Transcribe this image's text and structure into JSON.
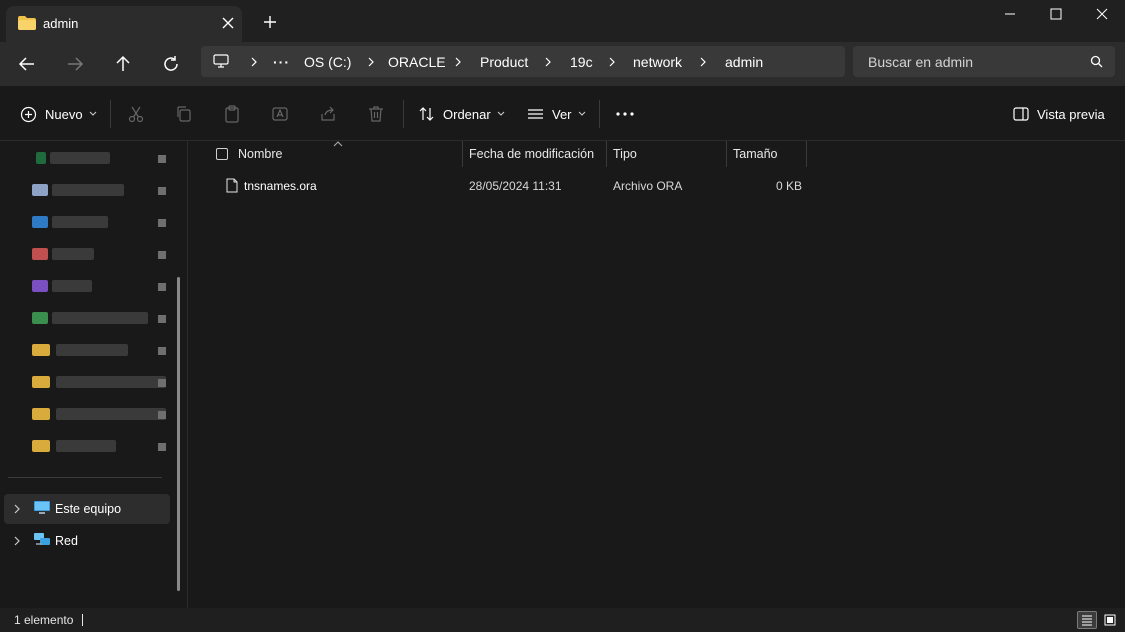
{
  "window": {
    "tab_title": "admin",
    "icons": {
      "folder": "folder-icon",
      "close_tab": "close-icon",
      "new_tab": "plus-icon"
    }
  },
  "nav": {
    "back": "arrow-left-icon",
    "forward": "arrow-right-icon",
    "up": "arrow-up-icon",
    "refresh": "refresh-icon",
    "breadcrumb": [
      "OS (C:)",
      "ORACLE",
      "Product",
      "19c",
      "network",
      "admin"
    ],
    "overflow": "···",
    "search_placeholder": "Buscar en admin"
  },
  "commands": {
    "new": "Nuevo",
    "sort": "Ordenar",
    "view": "Ver",
    "more": "···",
    "preview": "Vista previa"
  },
  "sidebar": {
    "this_pc": "Este equipo",
    "network": "Red"
  },
  "columns": {
    "name": "Nombre",
    "modified": "Fecha de modificación",
    "type": "Tipo",
    "size": "Tamaño"
  },
  "files": [
    {
      "name": "tnsnames.ora",
      "modified": "28/05/2024 11:31",
      "type": "Archivo ORA",
      "size": "0 KB"
    }
  ],
  "status": {
    "count": "1 elemento"
  },
  "colors": {
    "accent_folder": "#f0c24b",
    "background": "#191919",
    "toolbar": "#2c2c2c"
  }
}
